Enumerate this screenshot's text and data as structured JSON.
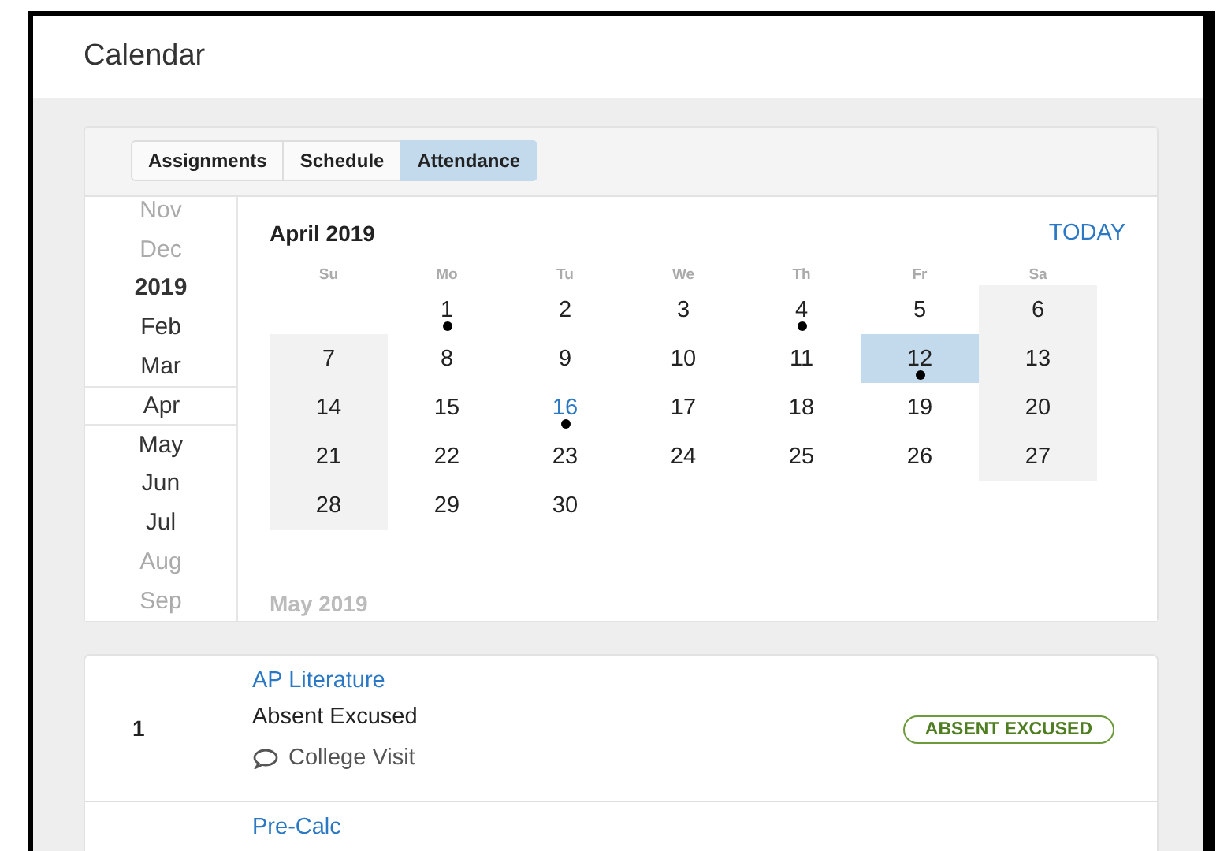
{
  "header": {
    "title": "Calendar"
  },
  "tabs": [
    {
      "label": "Assignments",
      "selected": false
    },
    {
      "label": "Schedule",
      "selected": false
    },
    {
      "label": "Attendance",
      "selected": true
    }
  ],
  "months": [
    {
      "label": "Nov",
      "kind": "month",
      "faded": true,
      "selected": false
    },
    {
      "label": "Dec",
      "kind": "month",
      "faded": true,
      "selected": false
    },
    {
      "label": "2019",
      "kind": "year",
      "faded": false,
      "selected": false
    },
    {
      "label": "Feb",
      "kind": "month",
      "faded": false,
      "selected": false
    },
    {
      "label": "Mar",
      "kind": "month",
      "faded": false,
      "selected": false
    },
    {
      "label": "Apr",
      "kind": "month",
      "faded": false,
      "selected": true
    },
    {
      "label": "May",
      "kind": "month",
      "faded": false,
      "selected": false
    },
    {
      "label": "Jun",
      "kind": "month",
      "faded": false,
      "selected": false
    },
    {
      "label": "Jul",
      "kind": "month",
      "faded": false,
      "selected": false
    },
    {
      "label": "Aug",
      "kind": "month",
      "faded": true,
      "selected": false
    },
    {
      "label": "Sep",
      "kind": "month",
      "faded": true,
      "selected": false
    }
  ],
  "calendar": {
    "title": "April 2019",
    "today_button": "TODAY",
    "next_month": "May 2019",
    "weekdays": [
      "Su",
      "Mo",
      "Tu",
      "We",
      "Th",
      "Fr",
      "Sa"
    ],
    "cells": [
      {
        "kind": "blank"
      },
      {
        "kind": "day",
        "day": "1",
        "weekend": false,
        "selected": false,
        "today": false,
        "event": true
      },
      {
        "kind": "day",
        "day": "2",
        "weekend": false,
        "selected": false,
        "today": false,
        "event": false
      },
      {
        "kind": "day",
        "day": "3",
        "weekend": false,
        "selected": false,
        "today": false,
        "event": false
      },
      {
        "kind": "day",
        "day": "4",
        "weekend": false,
        "selected": false,
        "today": false,
        "event": true
      },
      {
        "kind": "day",
        "day": "5",
        "weekend": false,
        "selected": false,
        "today": false,
        "event": false
      },
      {
        "kind": "day",
        "day": "6",
        "weekend": true,
        "selected": false,
        "today": false,
        "event": false
      },
      {
        "kind": "day",
        "day": "7",
        "weekend": true,
        "selected": false,
        "today": false,
        "event": false
      },
      {
        "kind": "day",
        "day": "8",
        "weekend": false,
        "selected": false,
        "today": false,
        "event": false
      },
      {
        "kind": "day",
        "day": "9",
        "weekend": false,
        "selected": false,
        "today": false,
        "event": false
      },
      {
        "kind": "day",
        "day": "10",
        "weekend": false,
        "selected": false,
        "today": false,
        "event": false
      },
      {
        "kind": "day",
        "day": "11",
        "weekend": false,
        "selected": false,
        "today": false,
        "event": false
      },
      {
        "kind": "day",
        "day": "12",
        "weekend": false,
        "selected": true,
        "today": false,
        "event": true
      },
      {
        "kind": "day",
        "day": "13",
        "weekend": true,
        "selected": false,
        "today": false,
        "event": false
      },
      {
        "kind": "day",
        "day": "14",
        "weekend": true,
        "selected": false,
        "today": false,
        "event": false
      },
      {
        "kind": "day",
        "day": "15",
        "weekend": false,
        "selected": false,
        "today": false,
        "event": false
      },
      {
        "kind": "day",
        "day": "16",
        "weekend": false,
        "selected": false,
        "today": true,
        "event": true
      },
      {
        "kind": "day",
        "day": "17",
        "weekend": false,
        "selected": false,
        "today": false,
        "event": false
      },
      {
        "kind": "day",
        "day": "18",
        "weekend": false,
        "selected": false,
        "today": false,
        "event": false
      },
      {
        "kind": "day",
        "day": "19",
        "weekend": false,
        "selected": false,
        "today": false,
        "event": false
      },
      {
        "kind": "day",
        "day": "20",
        "weekend": true,
        "selected": false,
        "today": false,
        "event": false
      },
      {
        "kind": "day",
        "day": "21",
        "weekend": true,
        "selected": false,
        "today": false,
        "event": false
      },
      {
        "kind": "day",
        "day": "22",
        "weekend": false,
        "selected": false,
        "today": false,
        "event": false
      },
      {
        "kind": "day",
        "day": "23",
        "weekend": false,
        "selected": false,
        "today": false,
        "event": false
      },
      {
        "kind": "day",
        "day": "24",
        "weekend": false,
        "selected": false,
        "today": false,
        "event": false
      },
      {
        "kind": "day",
        "day": "25",
        "weekend": false,
        "selected": false,
        "today": false,
        "event": false
      },
      {
        "kind": "day",
        "day": "26",
        "weekend": false,
        "selected": false,
        "today": false,
        "event": false
      },
      {
        "kind": "day",
        "day": "27",
        "weekend": true,
        "selected": false,
        "today": false,
        "event": false
      },
      {
        "kind": "day",
        "day": "28",
        "weekend": true,
        "selected": false,
        "today": false,
        "event": false
      },
      {
        "kind": "day",
        "day": "29",
        "weekend": false,
        "selected": false,
        "today": false,
        "event": false
      },
      {
        "kind": "day",
        "day": "30",
        "weekend": false,
        "selected": false,
        "today": false,
        "event": false
      }
    ]
  },
  "attendance": [
    {
      "period": "1",
      "course": "AP Literature",
      "status": "Absent Excused",
      "comment": "College Visit",
      "badge": "ABSENT EXCUSED"
    },
    {
      "course": "Pre-Calc"
    }
  ]
}
